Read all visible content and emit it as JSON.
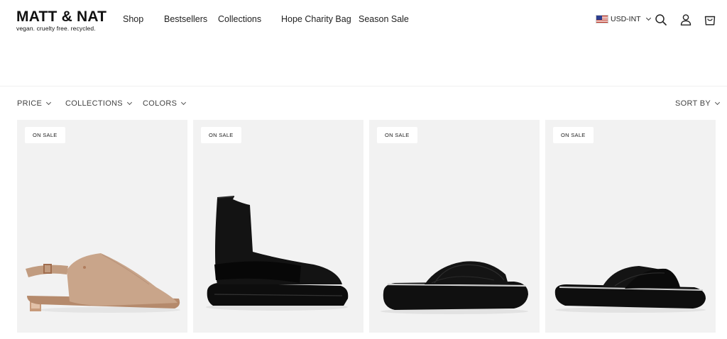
{
  "brand": {
    "name": "MATT & NAT",
    "tagline": "vegan. cruelty free. recycled."
  },
  "nav": {
    "items": [
      {
        "label": "Shop"
      },
      {
        "label": "Bestsellers"
      },
      {
        "label": "Collections"
      },
      {
        "label": "Hope Charity Bag"
      },
      {
        "label": "Season Sale"
      }
    ]
  },
  "header": {
    "currency": "USD-INT",
    "flag_icon": "us-flag-icon",
    "icons": [
      "search-icon",
      "account-icon",
      "cart-icon"
    ]
  },
  "filters": {
    "price": "PRICE",
    "collections": "COLLECTIONS",
    "colors": "COLORS",
    "sort": "SORT BY"
  },
  "products": [
    {
      "badge": "ON SALE",
      "image": "beige-slingback-sandal",
      "color": "#c9a58a"
    },
    {
      "badge": "ON SALE",
      "image": "black-sock-boot",
      "color": "#111111"
    },
    {
      "badge": "ON SALE",
      "image": "black-crossover-platform-slide",
      "color": "#151515"
    },
    {
      "badge": "ON SALE",
      "image": "black-crossover-slide",
      "color": "#151515"
    }
  ],
  "colors": {
    "background": "#ffffff",
    "card_background": "#f2f2f2",
    "text": "#1a1a1a"
  }
}
